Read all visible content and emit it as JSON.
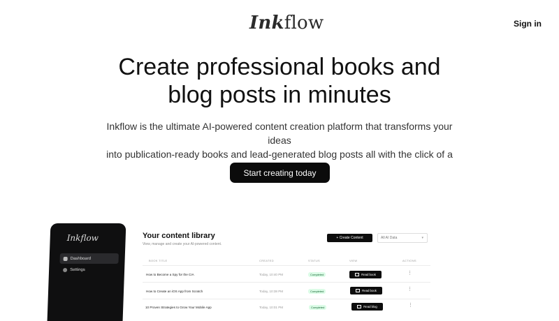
{
  "header": {
    "logo": {
      "ink": "Ink",
      "flow": "flow"
    },
    "sign_in": "Sign in"
  },
  "hero": {
    "title_line1": "Create professional books and",
    "title_line2": "blog posts in minutes",
    "subtitle_line1": "Inkflow is the ultimate AI-powered content creation platform that transforms your ideas",
    "subtitle_line2": "into publication-ready books and lead-generated blog posts all with the click of a button.",
    "cta_label": "Start creating today"
  },
  "preview": {
    "sidebar": {
      "logo": "Inkflow",
      "items": [
        {
          "label": "Dashboard",
          "icon": "book-icon",
          "active": true
        },
        {
          "label": "Settings",
          "icon": "gear-icon",
          "active": false
        }
      ]
    },
    "library": {
      "title": "Your content library",
      "subtitle": "View, manage and create your AI-powered content.",
      "create_button": "+ Create Content",
      "filter": {
        "selected": "All AI Data"
      },
      "columns": [
        "BOOK TITLE",
        "CREATED",
        "STATUS",
        "VIEW",
        "ACTIONS"
      ],
      "rows": [
        {
          "title": "How to Become a Spy for the CIA",
          "created": "Today, 10:40 PM",
          "status": "Completed",
          "view": "Read book"
        },
        {
          "title": "How to Create an iOS App from Scratch",
          "created": "Today, 10:38 PM",
          "status": "Completed",
          "view": "Read book"
        },
        {
          "title": "10 Proven Strategies to Grow Your Mobile App",
          "created": "Today, 10:01 PM",
          "status": "Completed",
          "view": "Read blog"
        }
      ]
    }
  },
  "colors": {
    "primary": "#0b0b0b",
    "status_bg": "#dcfce7",
    "status_text": "#166534",
    "sidebar_bg": "#0f0f10"
  }
}
